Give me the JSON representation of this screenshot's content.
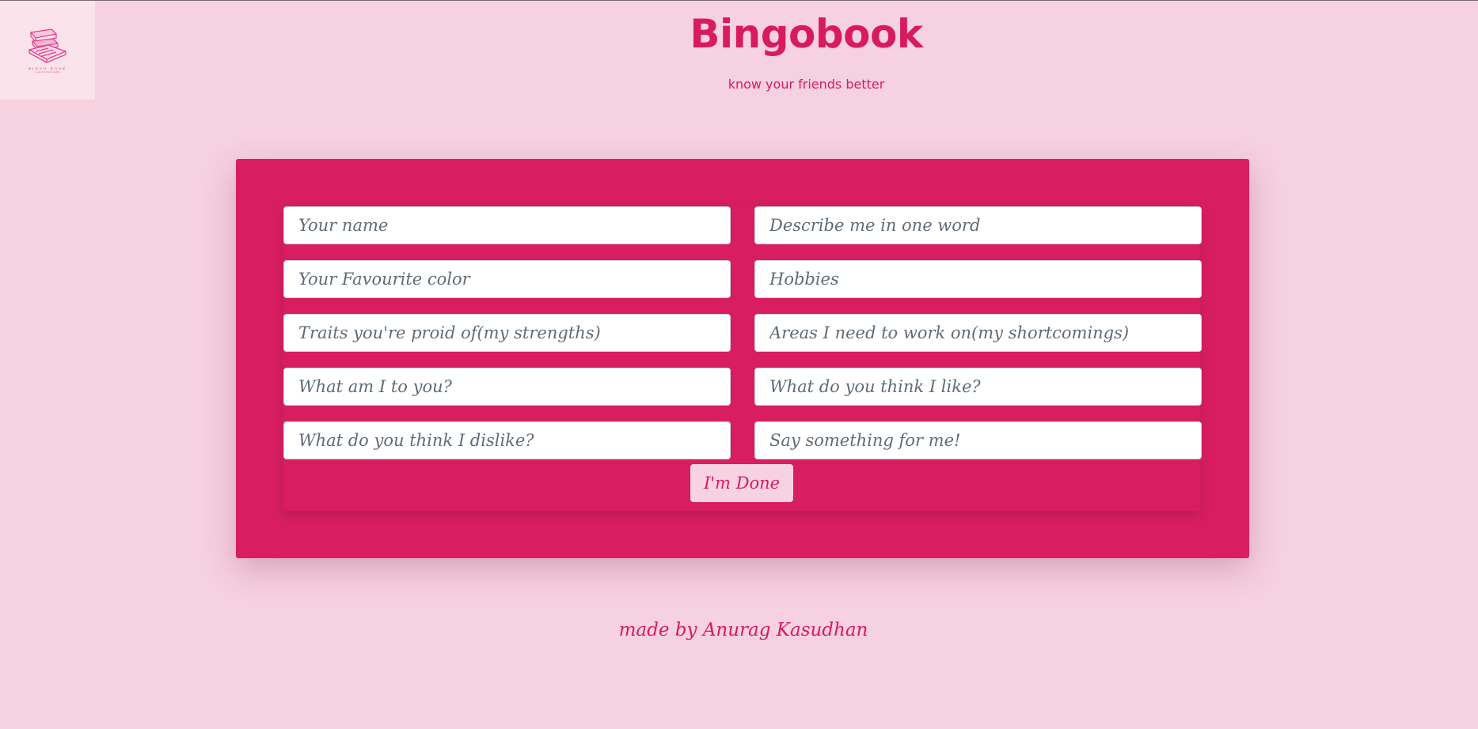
{
  "logo": {
    "icon": "stacked-books-icon",
    "text": "BINGO BOOK",
    "subtext": "know your friends better"
  },
  "header": {
    "title": "Bingobook",
    "tagline": "know your friends better"
  },
  "form": {
    "fields": [
      {
        "name": "your-name-input",
        "placeholder": "Your name"
      },
      {
        "name": "describe-me-input",
        "placeholder": "Describe me in one word"
      },
      {
        "name": "favourite-color-input",
        "placeholder": "Your Favourite color"
      },
      {
        "name": "hobbies-input",
        "placeholder": "Hobbies"
      },
      {
        "name": "strengths-input",
        "placeholder": "Traits you're proid of(my strengths)"
      },
      {
        "name": "shortcomings-input",
        "placeholder": "Areas I need to work on(my shortcomings)"
      },
      {
        "name": "what-am-i-input",
        "placeholder": "What am I to you?"
      },
      {
        "name": "likes-input",
        "placeholder": "What do you think I like?"
      },
      {
        "name": "dislikes-input",
        "placeholder": "What do you think I dislike?"
      },
      {
        "name": "say-something-input",
        "placeholder": "Say something for me!"
      }
    ],
    "submit_label": "I'm Done"
  },
  "footer": {
    "credit": "made by Anurag Kasudhan"
  },
  "colors": {
    "background": "#f6d1df",
    "accent": "#d81b60",
    "card": "#d81e61",
    "button_bg": "#f7d3e1"
  }
}
